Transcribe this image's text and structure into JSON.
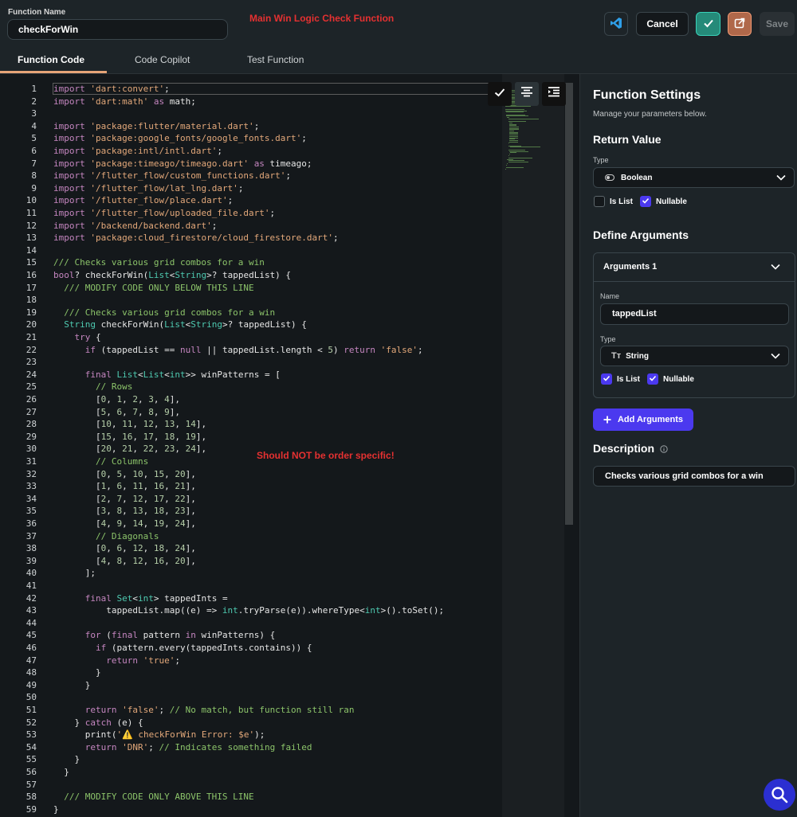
{
  "header": {
    "function_name_label": "Function Name",
    "function_name_value": "checkForWin",
    "annotation_top": "Main Win Logic Check Function",
    "cancel_label": "Cancel",
    "save_label": "Save"
  },
  "tabs": [
    {
      "label": "Function Code",
      "active": true
    },
    {
      "label": "Code Copilot",
      "active": false
    },
    {
      "label": "Test Function",
      "active": false
    }
  ],
  "editor": {
    "annotation_mid": "Should NOT be order specific!",
    "line_numbers": [
      "1",
      "2",
      "3",
      "4",
      "5",
      "6",
      "7",
      "8",
      "9",
      "10",
      "11",
      "12",
      "13",
      "14",
      "15",
      "16",
      "17",
      "18",
      "19",
      "20",
      "21",
      "22",
      "23",
      "24",
      "25",
      "26",
      "27",
      "28",
      "29",
      "30",
      "31",
      "32",
      "33",
      "34",
      "35",
      "36",
      "37",
      "38",
      "39",
      "40",
      "41",
      "42",
      "43",
      "44",
      "45",
      "46",
      "47",
      "48",
      "49",
      "50",
      "51",
      "52",
      "53",
      "54",
      "55",
      "56",
      "57",
      "58",
      "59"
    ],
    "lines": [
      "import 'dart:convert';",
      "import 'dart:math' as math;",
      "",
      "import 'package:flutter/material.dart';",
      "import 'package:google_fonts/google_fonts.dart';",
      "import 'package:intl/intl.dart';",
      "import 'package:timeago/timeago.dart' as timeago;",
      "import '/flutter_flow/custom_functions.dart';",
      "import '/flutter_flow/lat_lng.dart';",
      "import '/flutter_flow/place.dart';",
      "import '/flutter_flow/uploaded_file.dart';",
      "import '/backend/backend.dart';",
      "import 'package:cloud_firestore/cloud_firestore.dart';",
      "",
      "/// Checks various grid combos for a win",
      "bool? checkForWin(List<String>? tappedList) {",
      "  /// MODIFY CODE ONLY BELOW THIS LINE",
      "",
      "  /// Checks various grid combos for a win",
      "  String checkForWin(List<String>? tappedList) {",
      "    try {",
      "      if (tappedList == null || tappedList.length < 5) return 'false';",
      "",
      "      final List<List<int>> winPatterns = [",
      "        // Rows",
      "        [0, 1, 2, 3, 4],",
      "        [5, 6, 7, 8, 9],",
      "        [10, 11, 12, 13, 14],",
      "        [15, 16, 17, 18, 19],",
      "        [20, 21, 22, 23, 24],",
      "        // Columns",
      "        [0, 5, 10, 15, 20],",
      "        [1, 6, 11, 16, 21],",
      "        [2, 7, 12, 17, 22],",
      "        [3, 8, 13, 18, 23],",
      "        [4, 9, 14, 19, 24],",
      "        // Diagonals",
      "        [0, 6, 12, 18, 24],",
      "        [4, 8, 12, 16, 20],",
      "      ];",
      "",
      "      final Set<int> tappedInts =",
      "          tappedList.map((e) => int.tryParse(e)).whereType<int>().toSet();",
      "",
      "      for (final pattern in winPatterns) {",
      "        if (pattern.every(tappedInts.contains)) {",
      "          return 'true';",
      "        }",
      "      }",
      "",
      "      return 'false'; // No match, but function still ran",
      "    } catch (e) {",
      "      print('⚠️ checkForWin Error: $e');",
      "      return 'DNR'; // Indicates something failed",
      "    }",
      "  }",
      "",
      "  /// MODIFY CODE ONLY ABOVE THIS LINE",
      "}"
    ]
  },
  "settings": {
    "title": "Function Settings",
    "subtitle": "Manage your parameters below.",
    "return_value": {
      "title": "Return Value",
      "type_label": "Type",
      "type_value": "Boolean",
      "is_list_label": "Is List",
      "is_list_checked": false,
      "nullable_label": "Nullable",
      "nullable_checked": true
    },
    "arguments": {
      "title": "Define Arguments",
      "card_title": "Arguments 1",
      "name_label": "Name",
      "name_value": "tappedList",
      "type_label": "Type",
      "type_value": "String",
      "is_list_label": "Is List",
      "is_list_checked": true,
      "nullable_label": "Nullable",
      "nullable_checked": true,
      "add_label": "Add Arguments"
    },
    "description": {
      "title": "Description",
      "value": "Checks various grid combos for a win"
    }
  },
  "colors": {
    "accent": "#4b39ef",
    "confirm": "#258a79",
    "open": "#b0684a",
    "annotation": "#e53131"
  }
}
